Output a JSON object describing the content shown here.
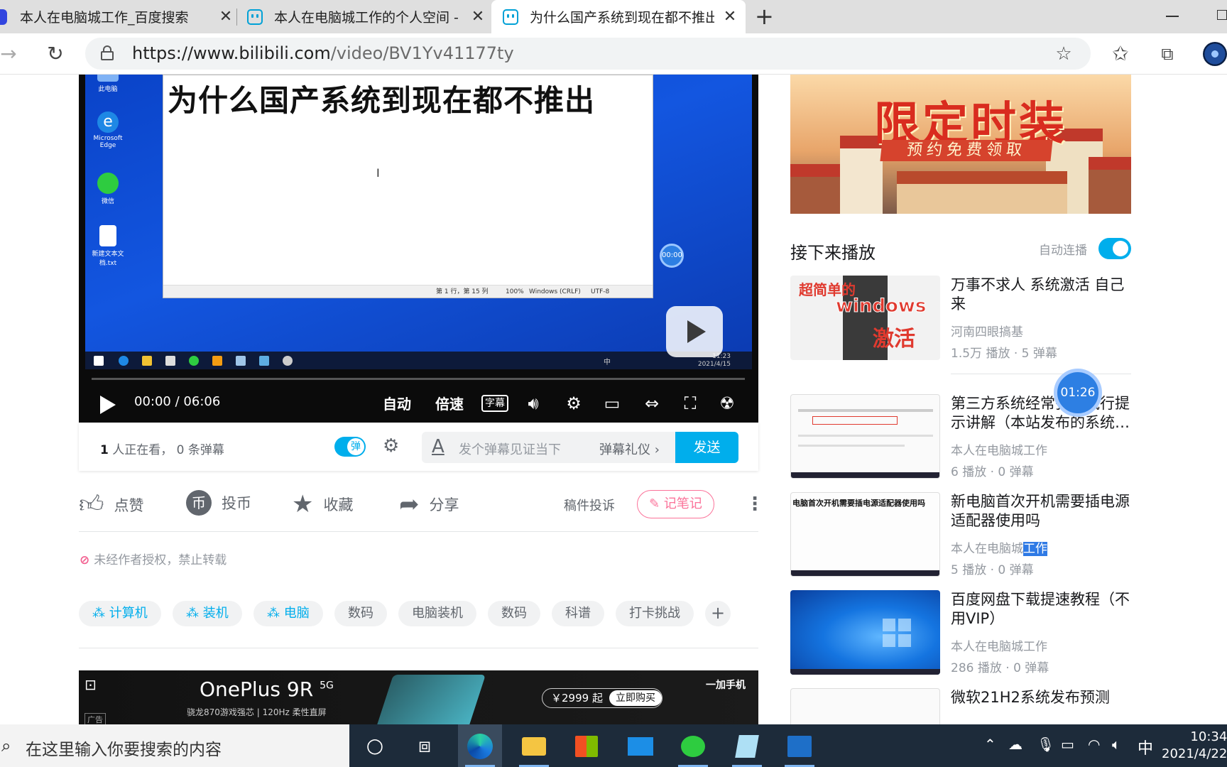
{
  "browser": {
    "tabs": [
      {
        "title": "本人在电脑城工作_百度搜索",
        "icon": "baidu-paw-icon",
        "active": false
      },
      {
        "title": "本人在电脑城工作的个人空间 - 哔",
        "icon": "bilibili-tv-icon",
        "active": false
      },
      {
        "title": "为什么国产系统到现在都不推出_",
        "icon": "bilibili-tv-icon",
        "active": true
      }
    ],
    "close_glyph": "✕",
    "new_tab_glyph": "+",
    "url_host": "https://www.bilibili.com",
    "url_path": "/video/BV1Yv41177ty"
  },
  "player": {
    "notepad_heading": "为什么国产系统到现在都不推出",
    "notepad_status": [
      "第 1 行，第 15 列",
      "100%",
      "Windows (CRLF)",
      "UTF-8"
    ],
    "desktop_icons": [
      "此电脑",
      "Microsoft Edge",
      "微信",
      "新建文本文档.txt"
    ],
    "inner_clock_time": "11:23",
    "inner_clock_date": "2021/4/15",
    "inner_ime": "中",
    "bubble_time": "00:00",
    "current_time": "00:00",
    "time_sep": "/",
    "duration": "06:06",
    "quality_label": "自动",
    "speed_label": "倍速",
    "subtitle_label": "字幕"
  },
  "danmaku": {
    "viewer_count": "1",
    "viewer_text": "人正在看，",
    "danmaku_count_text": "0 条弹幕",
    "toggle_label": "弹",
    "placeholder": "发个弹幕见证当下",
    "etiquette": "弹幕礼仪",
    "send_label": "发送"
  },
  "actions": {
    "like": "点赞",
    "coin": "投币",
    "favorite": "收藏",
    "share": "分享",
    "report": "稿件投诉",
    "note": "记笔记"
  },
  "copyright_text": "未经作者授权，禁止转载",
  "tags": [
    {
      "label": "计算机",
      "topic": true
    },
    {
      "label": "装机",
      "topic": true
    },
    {
      "label": "电脑",
      "topic": true
    },
    {
      "label": "数码",
      "topic": false
    },
    {
      "label": "电脑装机",
      "topic": false
    },
    {
      "label": "数码",
      "topic": false
    },
    {
      "label": "科谱",
      "topic": false
    },
    {
      "label": "打卡挑战",
      "topic": false
    }
  ],
  "ad": {
    "product": "OnePlus 9R",
    "product_sup": "5G",
    "subtitle": "骁龙870游戏强芯  |  120Hz 柔性直屏",
    "price": "￥2999 起",
    "buy": "立即购买",
    "brand": "一加手机",
    "label": "广告"
  },
  "banner": {
    "title": "限定时装",
    "subtitle": "预约免费领取"
  },
  "sidebar": {
    "upnext_title": "接下来播放",
    "autoplay_label": "自动连播",
    "floating_time": "01:26",
    "recommendations": [
      {
        "title": "万事不求人 系统激活 自己来",
        "uploader": "河南四眼搞基",
        "stats": "1.5万 播放 · 5 弹幕",
        "thumb_text_1": "超简单的",
        "thumb_text_2": "windows",
        "thumb_text_3": "激活"
      },
      {
        "title": "第三方系统经常弹窗执行提示讲解（本站发布的系统…",
        "uploader": "本人在电脑城工作",
        "stats": "6 播放 · 0 弹幕"
      },
      {
        "title": "新电脑首次开机需要插电源适配器使用吗",
        "uploader_prefix": "本人在电脑城",
        "uploader_highlight": "工作",
        "stats": "5 播放 · 0 弹幕",
        "thumb_text_1": "电脑首次开机需要插电源适配器使用吗"
      },
      {
        "title": "百度网盘下载提速教程（不用VIP）",
        "uploader": "本人在电脑城工作",
        "stats": "286 播放 · 0 弹幕"
      },
      {
        "title": "微软21H2系统发布预测"
      }
    ]
  },
  "taskbar": {
    "search_placeholder": "在这里输入你要搜索的内容",
    "ime": "中",
    "time": "10:34",
    "date": "2021/4/22"
  },
  "colors": {
    "bilibili_blue": "#00aeec",
    "bilibili_pink": "#fb7299",
    "taskbar": "#1d2b3a"
  }
}
